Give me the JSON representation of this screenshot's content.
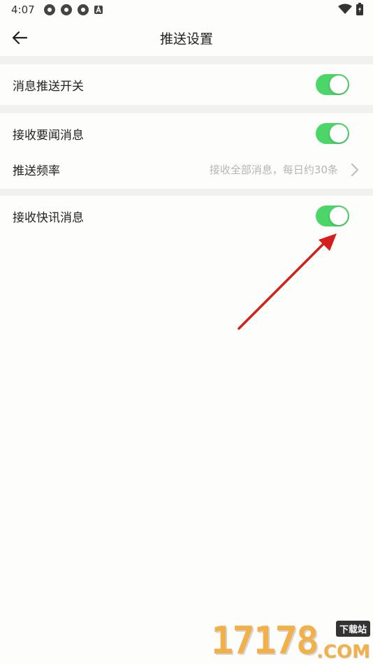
{
  "status_bar": {
    "time": "4:07",
    "icons": [
      "app-icon-1",
      "app-icon-2",
      "app-icon-3",
      "a-badge-icon"
    ],
    "right_icons": [
      "wifi-icon",
      "battery-icon"
    ]
  },
  "header": {
    "title": "推送设置",
    "back_icon": "arrow-left-icon"
  },
  "settings": {
    "push_switch": {
      "label": "消息推送开关",
      "enabled": true
    },
    "headline": {
      "label": "接收要闻消息",
      "enabled": true
    },
    "frequency": {
      "label": "推送频率",
      "value": "接收全部消息，每日约30条"
    },
    "flash": {
      "label": "接收快讯消息",
      "enabled": true
    }
  },
  "colors": {
    "toggle_on": "#4cd66a",
    "annotation_arrow": "#d81d1d"
  },
  "watermark": {
    "number": "17178",
    "tag": "下载站",
    "domain": ".COM"
  }
}
